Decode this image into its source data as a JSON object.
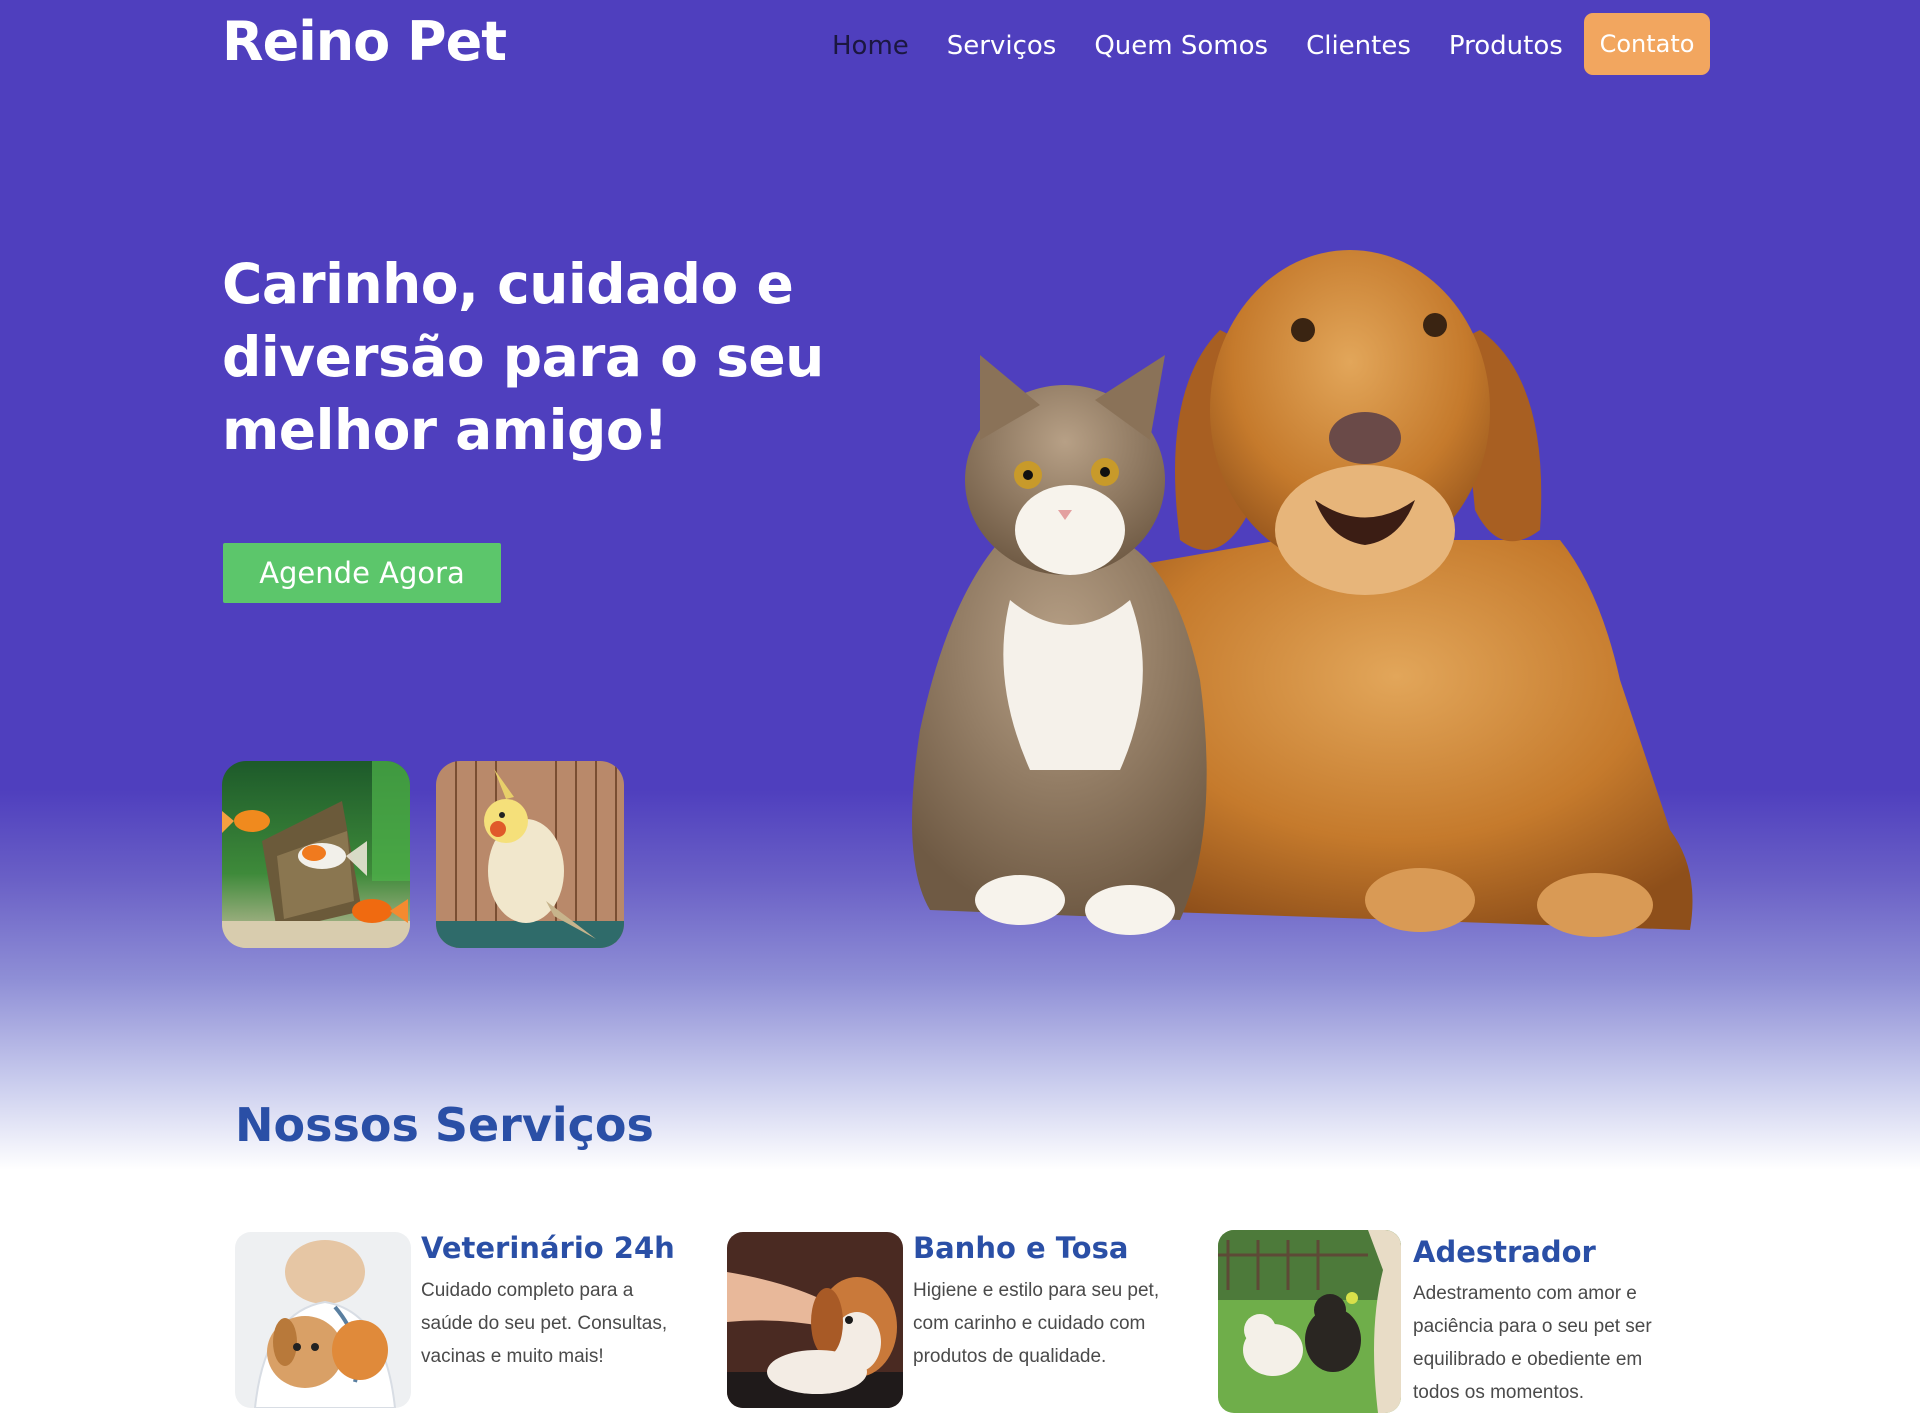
{
  "header": {
    "brand": "Reino Pet",
    "nav": [
      "Home",
      "Serviços",
      "Quem Somos",
      "Clientes",
      "Produtos"
    ],
    "contact_label": "Contato"
  },
  "hero": {
    "title_lines": [
      "Carinho, cuidado e",
      "diversão para o seu",
      "melhor amigo!"
    ],
    "cta_label": "Agende Agora"
  },
  "services": {
    "title": "Nossos Serviços",
    "items": [
      {
        "title": "Veterinário 24h",
        "description": "Cuidado completo para a saúde do seu pet. Consultas, vacinas e muito mais!"
      },
      {
        "title": "Banho e Tosa",
        "description": "Higiene e estilo para seu pet, com carinho e cuidado com produtos de qualidade."
      },
      {
        "title": "Adestrador",
        "description": "Adestramento com amor e paciência para o seu pet ser equilibrado e obediente em todos os momentos."
      }
    ]
  },
  "colors": {
    "hero_purple": "#4f3fbe",
    "accent_orange": "#f2a65f",
    "cta_green": "#5cc66b",
    "heading_blue": "#2a4fa6"
  }
}
